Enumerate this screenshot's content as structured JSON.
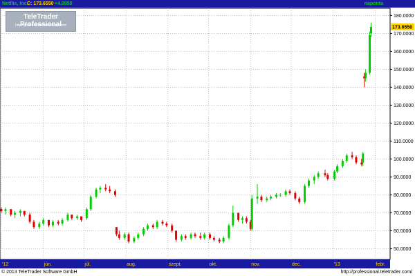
{
  "titlebar": {
    "name": "Netflix, Inc.",
    "close": "C: 173.6550",
    "change": "+4.0950",
    "period": "naponta"
  },
  "logo": {
    "brand": "TeleTrader Professional",
    "url": "http://professional.teletrader.com/"
  },
  "footer": {
    "copyright": "© 2013 TeleTrader Software GmbH",
    "url": "http://professional.teletrader.com/"
  },
  "colors": {
    "up": "#00cc00",
    "down": "#e00000",
    "titlebar_bg": "#1a1aa0",
    "axis_bar": "#1a1aa0",
    "grid": "#9a9a9a",
    "last_price_tag": "#ffd200"
  },
  "chart_data": {
    "type": "candlestick",
    "symbol": "Netflix, Inc.",
    "last_price": 173.655,
    "last_price_label": "173.6550",
    "ylim": [
      44,
      184
    ],
    "y_ticks": [
      50,
      60,
      70,
      80,
      90,
      100,
      110,
      120,
      130,
      140,
      150,
      160,
      170,
      180
    ],
    "y_tick_labels": [
      "50.0000",
      "60.0000",
      "70.0000",
      "80.0000",
      "90.0000",
      "100.0000",
      "110.0000",
      "120.0000",
      "130.0000",
      "140.0000",
      "150.0000",
      "160.0000",
      "170.0000",
      "180.0000"
    ],
    "x_start": "2012-05-01",
    "x_end": "2013-02-10",
    "x_ticks": [
      {
        "date": "2012-05-01",
        "label": "'12"
      },
      {
        "date": "2012-06-01",
        "label": "jún."
      },
      {
        "date": "2012-07-01",
        "label": "júl."
      },
      {
        "date": "2012-08-01",
        "label": "aug."
      },
      {
        "date": "2012-09-01",
        "label": "szept."
      },
      {
        "date": "2012-10-01",
        "label": "okt."
      },
      {
        "date": "2012-11-01",
        "label": "nov."
      },
      {
        "date": "2012-12-01",
        "label": "dec."
      },
      {
        "date": "2013-01-01",
        "label": "'13"
      },
      {
        "date": "2013-02-01",
        "label": "febr."
      }
    ],
    "grid": true,
    "series": [
      {
        "ohlc": [
          [
            "2012-05-01",
            72,
            73,
            70,
            71
          ],
          [
            "2012-05-04",
            71,
            73,
            69,
            72
          ],
          [
            "2012-05-08",
            72,
            72,
            68,
            69
          ],
          [
            "2012-05-11",
            69,
            71,
            67,
            70
          ],
          [
            "2012-05-15",
            70,
            72,
            68,
            71
          ],
          [
            "2012-05-18",
            71,
            71,
            68,
            69
          ],
          [
            "2012-05-22",
            69,
            70,
            64,
            65
          ],
          [
            "2012-05-25",
            65,
            66,
            61,
            62
          ],
          [
            "2012-05-29",
            62,
            65,
            61,
            64
          ],
          [
            "2012-06-01",
            64,
            67,
            63,
            66
          ],
          [
            "2012-06-05",
            66,
            66,
            62,
            63
          ],
          [
            "2012-06-08",
            63,
            66,
            62,
            65
          ],
          [
            "2012-06-12",
            65,
            66,
            63,
            64
          ],
          [
            "2012-06-15",
            64,
            67,
            63,
            66
          ],
          [
            "2012-06-19",
            66,
            70,
            65,
            69
          ],
          [
            "2012-06-22",
            69,
            69,
            66,
            67
          ],
          [
            "2012-06-26",
            67,
            69,
            66,
            68
          ],
          [
            "2012-06-29",
            68,
            68,
            65,
            66
          ],
          [
            "2012-07-03",
            67,
            73,
            66,
            72
          ],
          [
            "2012-07-06",
            72,
            80,
            71,
            79
          ],
          [
            "2012-07-10",
            79,
            84,
            78,
            83
          ],
          [
            "2012-07-13",
            83,
            85,
            81,
            84
          ],
          [
            "2012-07-17",
            84,
            86,
            82,
            83
          ],
          [
            "2012-07-20",
            83,
            85,
            81,
            82
          ],
          [
            "2012-07-24",
            82,
            83,
            79,
            80
          ],
          [
            "2012-07-25",
            62,
            62,
            57,
            58
          ],
          [
            "2012-07-27",
            58,
            60,
            55,
            56
          ],
          [
            "2012-07-31",
            56,
            59,
            55,
            58
          ],
          [
            "2012-08-03",
            58,
            59,
            53,
            54
          ],
          [
            "2012-08-07",
            54,
            57,
            53,
            56
          ],
          [
            "2012-08-10",
            56,
            59,
            55,
            58
          ],
          [
            "2012-08-14",
            58,
            62,
            57,
            61
          ],
          [
            "2012-08-17",
            61,
            64,
            60,
            63
          ],
          [
            "2012-08-21",
            63,
            64,
            61,
            62
          ],
          [
            "2012-08-24",
            62,
            66,
            61,
            65
          ],
          [
            "2012-08-28",
            65,
            66,
            63,
            64
          ],
          [
            "2012-08-31",
            64,
            65,
            62,
            63
          ],
          [
            "2012-09-04",
            63,
            64,
            59,
            60
          ],
          [
            "2012-09-07",
            60,
            60,
            54,
            55
          ],
          [
            "2012-09-11",
            55,
            58,
            54,
            57
          ],
          [
            "2012-09-14",
            57,
            58,
            55,
            56
          ],
          [
            "2012-09-18",
            56,
            59,
            55,
            58
          ],
          [
            "2012-09-21",
            58,
            59,
            56,
            57
          ],
          [
            "2012-09-25",
            57,
            59,
            55,
            56
          ],
          [
            "2012-09-28",
            56,
            59,
            55,
            58
          ],
          [
            "2012-10-02",
            58,
            59,
            55,
            56
          ],
          [
            "2012-10-05",
            56,
            57,
            54,
            55
          ],
          [
            "2012-10-09",
            55,
            56,
            53,
            54
          ],
          [
            "2012-10-12",
            54,
            57,
            53,
            56
          ],
          [
            "2012-10-16",
            56,
            64,
            55,
            63
          ],
          [
            "2012-10-19",
            63,
            74,
            62,
            70
          ],
          [
            "2012-10-23",
            70,
            70,
            65,
            66
          ],
          [
            "2012-10-26",
            66,
            68,
            64,
            67
          ],
          [
            "2012-10-29",
            67,
            68,
            64,
            65
          ],
          [
            "2012-11-01",
            65,
            66,
            60,
            61
          ],
          [
            "2012-11-02",
            61,
            80,
            60,
            78
          ],
          [
            "2012-11-06",
            78,
            86,
            75,
            79
          ],
          [
            "2012-11-09",
            79,
            80,
            76,
            77
          ],
          [
            "2012-11-13",
            77,
            79,
            76,
            78
          ],
          [
            "2012-11-16",
            78,
            80,
            77,
            79
          ],
          [
            "2012-11-20",
            79,
            81,
            78,
            80
          ],
          [
            "2012-11-23",
            80,
            81,
            79,
            80
          ],
          [
            "2012-11-27",
            80,
            83,
            79,
            82
          ],
          [
            "2012-11-30",
            82,
            83,
            80,
            81
          ],
          [
            "2012-12-04",
            81,
            82,
            77,
            78
          ],
          [
            "2012-12-07",
            78,
            79,
            75,
            76
          ],
          [
            "2012-12-11",
            76,
            86,
            75,
            85
          ],
          [
            "2012-12-14",
            85,
            89,
            84,
            88
          ],
          [
            "2012-12-18",
            88,
            91,
            86,
            90
          ],
          [
            "2012-12-21",
            90,
            93,
            89,
            92
          ],
          [
            "2012-12-26",
            92,
            94,
            90,
            91
          ],
          [
            "2012-12-28",
            91,
            92,
            88,
            89
          ],
          [
            "2013-01-02",
            89,
            94,
            88,
            93
          ],
          [
            "2013-01-04",
            93,
            97,
            92,
            96
          ],
          [
            "2013-01-08",
            96,
            100,
            95,
            99
          ],
          [
            "2013-01-11",
            99,
            103,
            98,
            102
          ],
          [
            "2013-01-15",
            102,
            104,
            100,
            101
          ],
          [
            "2013-01-18",
            101,
            102,
            97,
            98
          ],
          [
            "2013-01-22",
            98,
            100,
            96,
            97
          ],
          [
            "2013-01-23",
            98,
            104,
            96,
            103
          ],
          [
            "2013-01-24",
            146,
            148,
            140,
            145
          ],
          [
            "2013-01-25",
            145,
            150,
            143,
            148
          ],
          [
            "2013-01-28",
            148,
            171,
            147,
            169
          ],
          [
            "2013-01-29",
            170,
            176,
            168,
            173.655
          ]
        ]
      }
    ]
  }
}
